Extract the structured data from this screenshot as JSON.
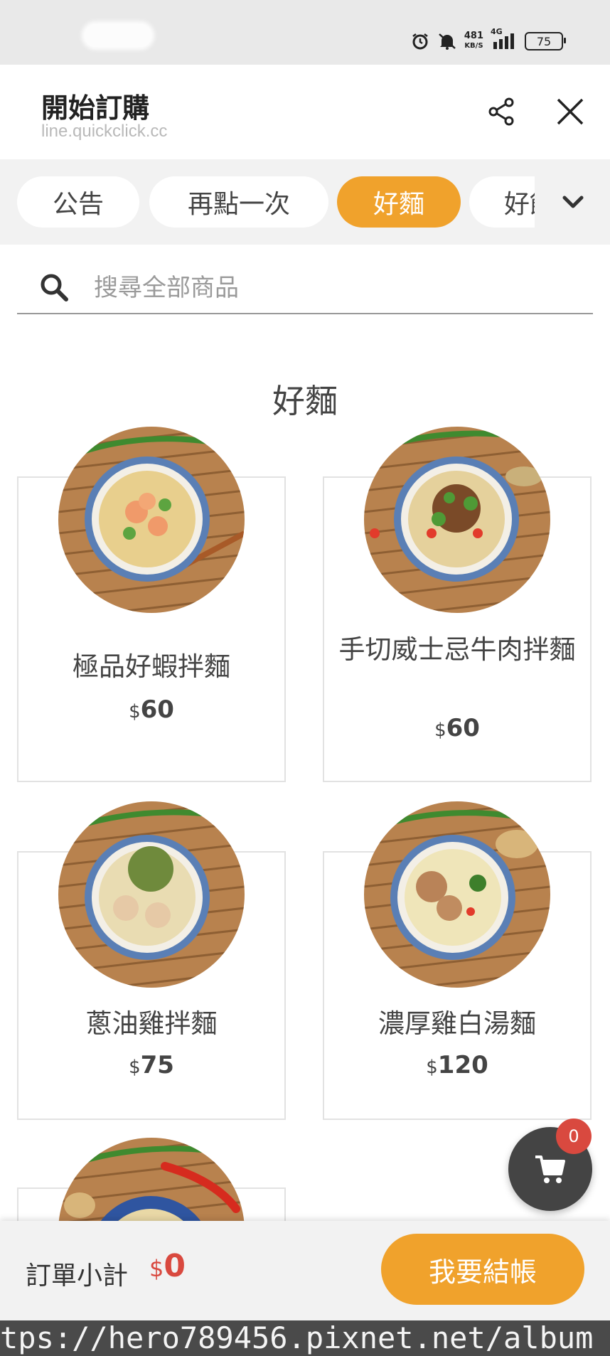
{
  "status_bar": {
    "speed_value": "481",
    "speed_unit": "KB/S",
    "network": "4G",
    "battery": "75"
  },
  "header": {
    "title": "開始訂購",
    "subtitle": "line.quickclick.cc"
  },
  "tabs": [
    {
      "label": "公告",
      "active": false
    },
    {
      "label": "再點一次",
      "active": false
    },
    {
      "label": "好麵",
      "active": true
    },
    {
      "label": "好飯",
      "active": false
    }
  ],
  "search": {
    "placeholder": "搜尋全部商品",
    "value": ""
  },
  "section": {
    "title": "好麵"
  },
  "products": [
    {
      "name": "極品好蝦拌麵",
      "currency": "$",
      "price": "60"
    },
    {
      "name": "手切威士忌牛肉拌麵",
      "currency": "$",
      "price": "60"
    },
    {
      "name": "蔥油雞拌麵",
      "currency": "$",
      "price": "75"
    },
    {
      "name": "濃厚雞白湯麵",
      "currency": "$",
      "price": "120"
    }
  ],
  "cart": {
    "count": "0"
  },
  "bottom": {
    "subtotal_label": "訂單小計",
    "currency": "$",
    "subtotal_value": "0",
    "checkout_label": "我要結帳"
  },
  "watermark": "tps://hero789456.pixnet.net/album",
  "colors": {
    "accent": "#f0a22c",
    "price_red": "#d9493f",
    "fab": "#444444"
  }
}
